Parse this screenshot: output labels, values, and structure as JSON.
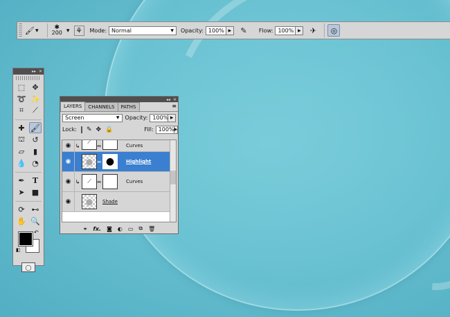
{
  "toolbar": {
    "brush_size": "200",
    "mode_label": "Mode:",
    "mode_value": "Normal",
    "opacity_label": "Opacity:",
    "opacity_value": "100%",
    "flow_label": "Flow:",
    "flow_value": "100%"
  },
  "layers_panel": {
    "tabs": [
      "LAYERS",
      "CHANNELS",
      "PATHS"
    ],
    "blend_mode": "Screen",
    "opacity_label": "Opacity:",
    "opacity_value": "100%",
    "lock_label": "Lock:",
    "fill_label": "Fill:",
    "fill_value": "100%",
    "layers": [
      {
        "name": "Curves"
      },
      {
        "name": "Highlight"
      },
      {
        "name": "Curves"
      },
      {
        "name": "Shade"
      }
    ],
    "footer_fx": "fx."
  },
  "colors": {
    "canvas": "#63bccd",
    "panel": "#d6d6d6",
    "selected_layer": "#3a7fd0"
  }
}
